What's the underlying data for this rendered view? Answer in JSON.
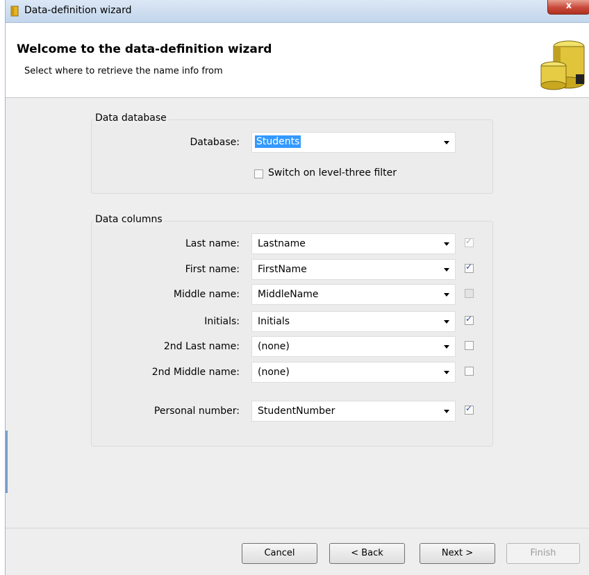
{
  "window": {
    "title": "Data-definition wizard",
    "close_glyph": "x"
  },
  "header": {
    "title": "Welcome to the data-definition wizard",
    "subtitle": "Select where to retrieve the name info from",
    "icon": "database-coins-icon"
  },
  "database_group": {
    "label": "Data database",
    "database_label": "Database:",
    "database_value": "Students",
    "filter_label": "Switch on level-three filter",
    "filter_checked": false
  },
  "columns_group": {
    "label": "Data columns",
    "rows": [
      {
        "label": "Last name:",
        "value": "Lastname",
        "checked": true,
        "enabled": false
      },
      {
        "label": "First name:",
        "value": "FirstName",
        "checked": true,
        "enabled": true
      },
      {
        "label": "Middle name:",
        "value": "MiddleName",
        "checked": false,
        "enabled": true,
        "grayed": true
      },
      {
        "label": "Initials:",
        "value": "Initials",
        "checked": true,
        "enabled": true
      },
      {
        "label": "2nd Last name:",
        "value": "(none)",
        "checked": false,
        "enabled": true
      },
      {
        "label": "2nd Middle name:",
        "value": "(none)",
        "checked": false,
        "enabled": true
      }
    ],
    "personal_number": {
      "label": "Personal number:",
      "value": "StudentNumber",
      "checked": true,
      "enabled": true
    }
  },
  "buttons": {
    "cancel": "Cancel",
    "back": "< Back",
    "next": "Next >",
    "finish": "Finish",
    "finish_enabled": false
  },
  "colors": {
    "selection": "#3399ff",
    "title_bar": "#c3d6ec",
    "close_button": "#c8483a"
  }
}
